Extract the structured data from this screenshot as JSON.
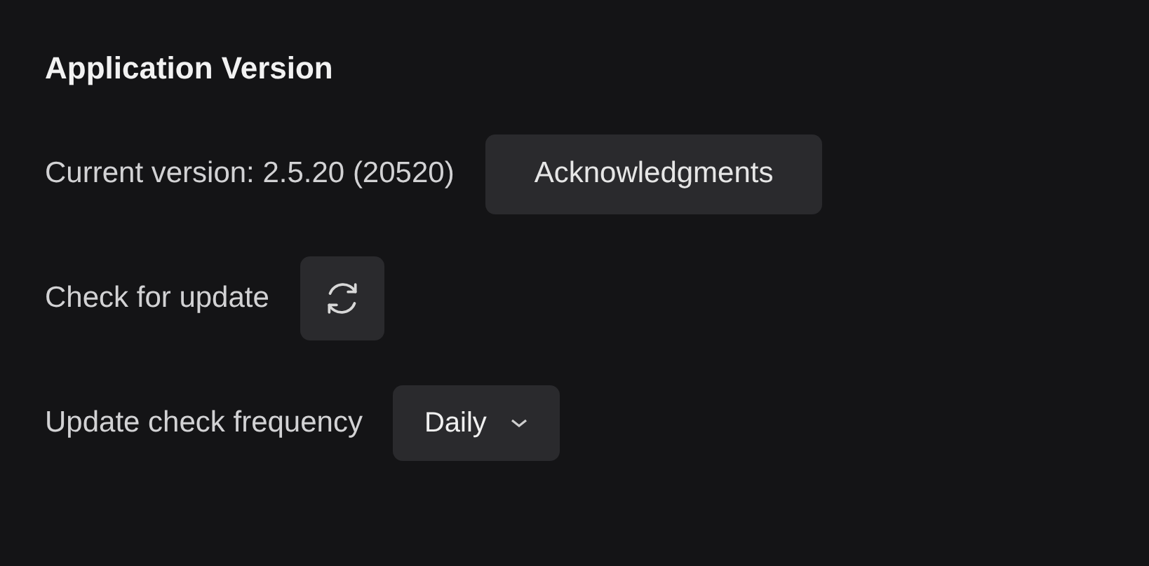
{
  "section": {
    "title": "Application Version"
  },
  "rows": [
    {
      "kind": "button",
      "label": "Current version: 2.5.20 (20520)",
      "button": "Acknowledgments"
    },
    {
      "kind": "icon-button",
      "label": "Check for update"
    },
    {
      "kind": "dropdown",
      "label": "Update check frequency",
      "value": "Daily"
    }
  ]
}
